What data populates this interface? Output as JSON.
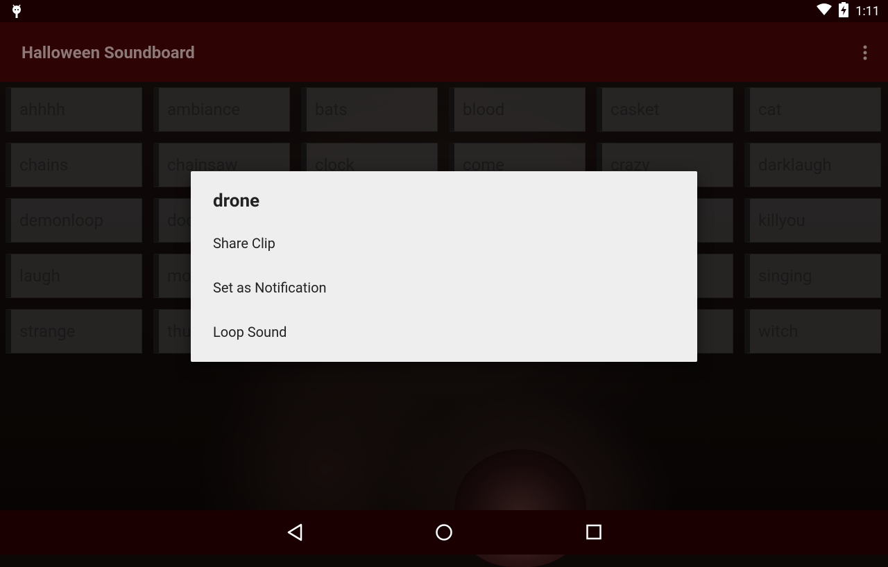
{
  "status_bar": {
    "time": "1:11"
  },
  "app_bar": {
    "title": "Halloween Soundboard"
  },
  "sounds": [
    "ahhhh",
    "ambiance",
    "bats",
    "blood",
    "casket",
    "cat",
    "chains",
    "chainsaw",
    "clock",
    "come",
    "crazy",
    "darklaugh",
    "demonloop",
    "doo",
    "",
    "",
    "",
    "killyou",
    "laugh",
    "mo",
    "",
    "",
    "",
    "singing",
    "strange",
    "thu",
    "",
    "",
    "",
    "witch"
  ],
  "dialog": {
    "title": "drone",
    "items": [
      "Share Clip",
      "Set as Notification",
      "Loop Sound"
    ]
  },
  "colors": {
    "status_bar": "#1a0000",
    "app_bar": "#2e0303",
    "dialog_bg": "#eeeeee"
  }
}
